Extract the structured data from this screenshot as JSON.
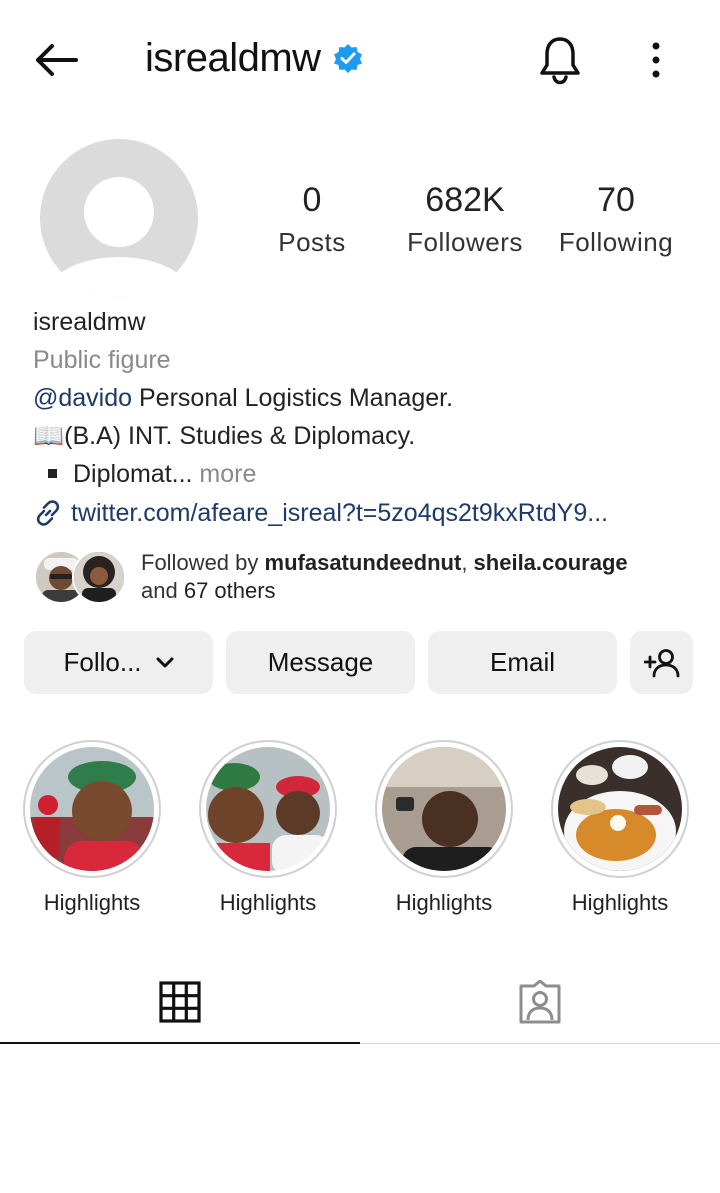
{
  "header": {
    "username": "isrealdmw",
    "icons": {
      "back": "arrow-left-icon",
      "verified": "verified-badge-icon",
      "bell": "bell-icon",
      "more": "more-vertical-icon"
    }
  },
  "stats": [
    {
      "value": "0",
      "label": "Posts"
    },
    {
      "value": "682K",
      "label": "Followers"
    },
    {
      "value": "70",
      "label": "Following"
    }
  ],
  "bio": {
    "name": "isrealdmw",
    "category": "Public figure",
    "mention": "@davido",
    "line1_rest": " Personal Logistics Manager.",
    "line2_emoji": "📖",
    "line2_text": "(B.A) INT. Studies & Diplomacy.",
    "line3_text": "Diplomat...",
    "more": " more",
    "link": "twitter.com/afeare_isreal?t=5zo4qs2t9kxRtdY9..."
  },
  "followed_by": {
    "prefix": "Followed by ",
    "user1": "mufasatundeednut",
    "sep": ", ",
    "user2": "sheila.courage",
    "and": "and ",
    "others": "67 others"
  },
  "buttons": {
    "follow": "Follo...",
    "message": "Message",
    "email": "Email"
  },
  "highlights": [
    {
      "label": "Highlights"
    },
    {
      "label": "Highlights"
    },
    {
      "label": "Highlights"
    },
    {
      "label": "Highlights"
    }
  ],
  "tabs": {
    "grid_icon": "grid-icon",
    "tagged_icon": "tagged-person-icon"
  },
  "colors": {
    "verified": "#1d9bf0",
    "link": "#1e3b66",
    "button_bg": "#efefef",
    "muted": "#8a8a8a"
  }
}
